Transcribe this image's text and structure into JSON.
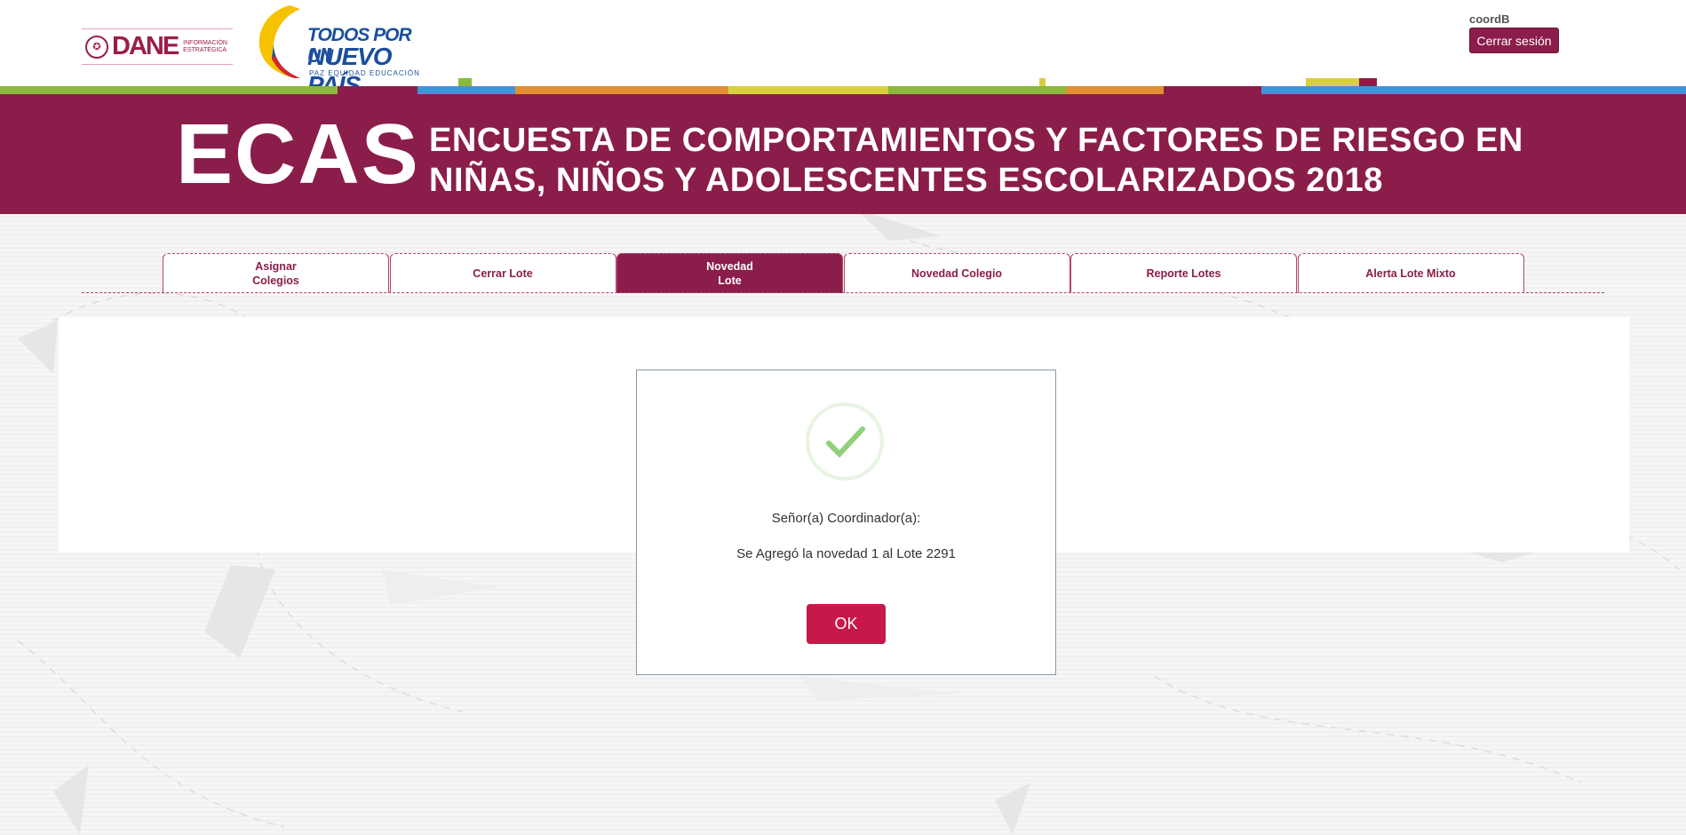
{
  "header": {
    "dane_logo_text": "DANE",
    "dane_logo_sub": "INFORMACIÓN ESTRATÉGICA",
    "gov_logo_line1": "TODOS POR UN",
    "gov_logo_line2": "NUEVO PAÍS",
    "gov_logo_line3": "PAZ  EQUIDAD  EDUCACIÓN",
    "username": "coordB",
    "logout_label": "Cerrar sesión"
  },
  "banner": {
    "acronym": "ECAS",
    "title_line1": "ENCUESTA DE COMPORTAMIENTOS Y FACTORES DE RIESGO EN",
    "title_line2": "NIÑAS, NIÑOS Y ADOLESCENTES ESCOLARIZADOS 2018"
  },
  "tabs": [
    {
      "label": "Asignar\nColegios",
      "active": false
    },
    {
      "label": "Cerrar Lote",
      "active": false
    },
    {
      "label": "Novedad\nLote",
      "active": true
    },
    {
      "label": "Novedad Colegio",
      "active": false
    },
    {
      "label": "Reporte Lotes",
      "active": false
    },
    {
      "label": "Alerta Lote Mixto",
      "active": false
    }
  ],
  "modal": {
    "icon": "check-icon",
    "title": "Señor(a) Coordinador(a):",
    "message": "Se Agregó la novedad 1 al Lote 2291",
    "ok_label": "OK"
  },
  "colors": {
    "brand": "#8b1d4a",
    "ok_button": "#c8184a",
    "check": "#8fd17a"
  }
}
